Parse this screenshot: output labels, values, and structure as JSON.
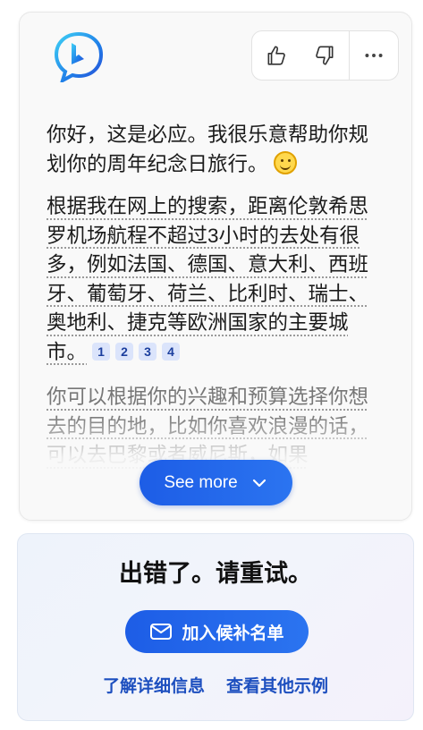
{
  "chat": {
    "paragraph1": "你好，这是必应。我很乐意帮助你规划你的周年纪念日旅行。",
    "paragraph2": "根据我在网上的搜索，距离伦敦希思罗机场航程不超过3小时的去处有很多，例如法国、德国、意大利、西班牙、葡萄牙、荷兰、比利时、瑞士、奥地利、捷克等欧洲国家的主要城市。",
    "citations": [
      "1",
      "2",
      "3",
      "4"
    ],
    "paragraph3": "你可以根据你的兴趣和预算选择你想去的目的地，比如你喜欢浪漫的话，可以去巴黎或者威尼斯，如果",
    "see_more_label": "See more"
  },
  "feedback": {
    "icons": [
      "thumbs-up-icon",
      "thumbs-down-icon",
      "more-icon"
    ]
  },
  "error": {
    "title": "出错了。请重试。",
    "waitlist_label": "加入候补名单",
    "link_learn_more": "了解详细信息",
    "link_examples": "查看其他示例"
  },
  "colors": {
    "accent": "#1d5de6",
    "link": "#1d4fbf",
    "citation_bg": "#dbe4fb"
  }
}
